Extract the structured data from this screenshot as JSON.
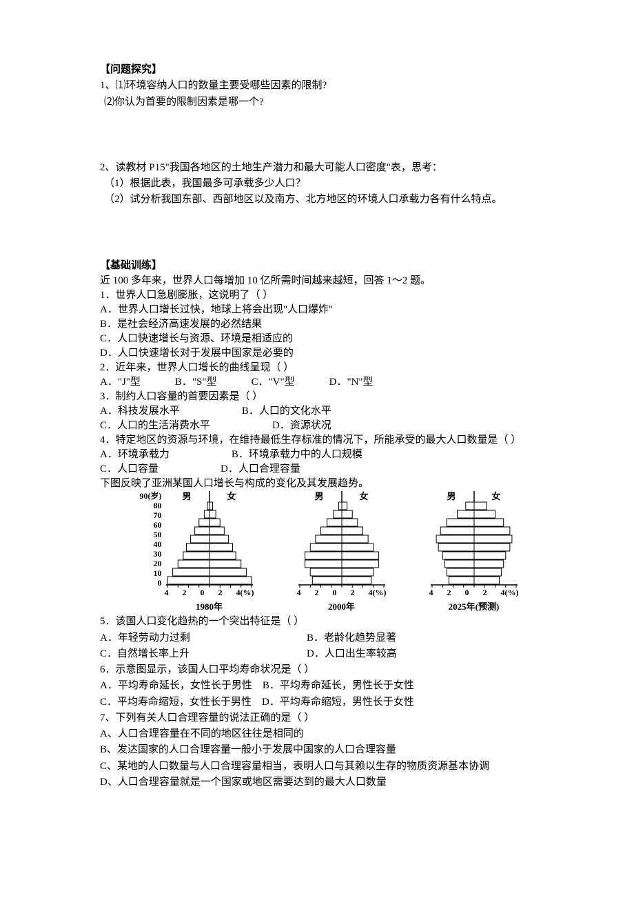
{
  "section1_title": "【问题探究】",
  "q1_line1": "1、⑴环境容纳人口的数量主要受哪些因素的限制?",
  "q1_line2": "⑵你认为首要的限制因素是哪一个?",
  "q2_line1": "2、读教材 P15\"我国各地区的土地生产潜力和最大可能人口密度\"表，思考：",
  "q2_sub1": "（1）根据此表，我国最多可承载多少人口？",
  "q2_sub2": "（2）试分析我国东部、西部地区以及南方、北方地区的环境人口承载力各有什么特点。",
  "section2_title": "【基础训练】",
  "intro_line": "近 100 多年来，世界人口每增加 10 亿所需时间越来越短，回答 1～2 题。",
  "q_1": "1．世界人口急剧膨胀，这说明了（  ）",
  "q1_a": "A．世界人口增长过快，地球上将会出现\"人口爆炸\"",
  "q1_b": "B．是社会经济高速发展的必然结果",
  "q1_c": "C．人口快速增长与资源、环境是相适应的",
  "q1_d": "D．人口快速增长对于发展中国家是必要的",
  "q_2": "2．近年来，世界人口增长的曲线呈现（  ）",
  "q2_a": "A．\"J\"型",
  "q2_b": "B．\"S\"型",
  "q2_c": "C．\"V\"型",
  "q2_d": "D．\"N\"型",
  "q_3": "3．制约人口容量的首要因素是（  ）",
  "q3_a": "A．科技发展水平",
  "q3_b": "B．人口的文化水平",
  "q3_c": "C．人口的生活消费水平",
  "q3_d": "D．资源状况",
  "q_4": "4．特定地区的资源与环境，在维持最低生存标准的情况下，所能承受的最大人口数量是（  ）",
  "q4_a": "A．环境承载力",
  "q4_b": "B．环境承载力中的人口规模",
  "q4_c": "C．人口容量",
  "q4_d": "D．人口合理容量",
  "chart_intro": "下图反映了亚洲某国人口增长与构成的变化及其发展趋势。",
  "y_top": "90(岁)",
  "y_labels": [
    "80",
    "70",
    "60",
    "50",
    "40",
    "30",
    "20",
    "10",
    "0"
  ],
  "male_label": "男",
  "female_label": "女",
  "x_ticks": [
    "4",
    "2",
    "0",
    "2",
    "4"
  ],
  "x_unit_first": "4(%)",
  "year_1980": "1980年",
  "year_2000": "2000年",
  "year_2025": "2025年(预测)",
  "q_5": "5．该国人口变化趋热的一个突出特征是（  ）",
  "q5_a": "A．年轻劳动力过剩",
  "q5_b": "B．老龄化趋势显著",
  "q5_c": "C．自然增长率上升",
  "q5_d": "D．人口出生率较高",
  "q_6": "6．示意图显示，该国人口平均寿命状况是（  ）",
  "q6_a": "A．平均寿命延长，女性长于男性",
  "q6_b": "B．平均寿命延长，男性长于女性",
  "q6_c": "C．平均寿命缩短，女性长于男性",
  "q6_d": "D．平均寿命缩短，男性长于女性",
  "q_7": "7、下列有关人口合理容量的说法正确的是（    ）",
  "q7_a": "A、人口合理容量在不同的地区往往是相同的",
  "q7_b": "B、发达国家的人口合理容量一般小于发展中国家的人口合理容量",
  "q7_c": "C、某地的人口数量与人口合理容量相当，表明人口与其赖以生存的物质资源基本协调",
  "q7_d": "D、人口合理容量就是一个国家或地区需要达到的最大人口数量",
  "chart_data": [
    {
      "type": "bar",
      "title": "1980年 population pyramid",
      "xlabel": "%",
      "ylabel": "岁",
      "ylim": [
        0,
        90
      ],
      "categories": [
        "0",
        "10",
        "20",
        "30",
        "40",
        "50",
        "60",
        "70",
        "80",
        "90"
      ],
      "series": [
        {
          "name": "男",
          "values": [
            4.0,
            3.5,
            3.0,
            2.5,
            2.2,
            1.8,
            1.4,
            1.0,
            0.5,
            0.2
          ]
        },
        {
          "name": "女",
          "values": [
            4.0,
            3.5,
            3.0,
            2.5,
            2.2,
            1.8,
            1.4,
            1.0,
            0.6,
            0.3
          ]
        }
      ]
    },
    {
      "type": "bar",
      "title": "2000年 population pyramid",
      "xlabel": "%",
      "ylabel": "岁",
      "ylim": [
        0,
        90
      ],
      "categories": [
        "0",
        "10",
        "20",
        "30",
        "40",
        "50",
        "60",
        "70",
        "80",
        "90"
      ],
      "series": [
        {
          "name": "男",
          "values": [
            2.8,
            3.0,
            3.5,
            3.5,
            3.0,
            2.5,
            2.0,
            1.4,
            0.8,
            0.3
          ]
        },
        {
          "name": "女",
          "values": [
            2.8,
            3.0,
            3.5,
            3.5,
            3.0,
            2.5,
            2.0,
            1.5,
            1.0,
            0.5
          ]
        }
      ]
    },
    {
      "type": "bar",
      "title": "2025年(预测) population pyramid",
      "xlabel": "%",
      "ylabel": "岁",
      "ylim": [
        0,
        90
      ],
      "categories": [
        "0",
        "10",
        "20",
        "30",
        "40",
        "50",
        "60",
        "70",
        "80",
        "90"
      ],
      "series": [
        {
          "name": "男",
          "values": [
            2.4,
            2.6,
            2.8,
            3.0,
            3.4,
            3.6,
            3.2,
            2.6,
            1.6,
            0.8
          ]
        },
        {
          "name": "女",
          "values": [
            2.4,
            2.6,
            2.8,
            3.0,
            3.4,
            3.6,
            3.4,
            2.8,
            2.0,
            1.2
          ]
        }
      ]
    }
  ]
}
